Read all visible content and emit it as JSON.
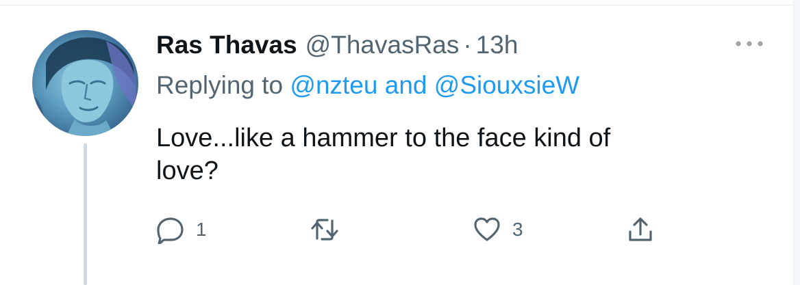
{
  "tweet": {
    "author_name": "Ras Thavas",
    "author_handle": "@ThavasRas",
    "separator": "·",
    "time": "13h",
    "replying_prefix": "Replying to",
    "mention_1": "@nzteu",
    "replying_join": "and",
    "mention_2": "@SiouxsieW",
    "text_line_1": "Love...like a hammer to the face kind of",
    "text_line_2": "love?"
  },
  "actions": {
    "reply_count": "1",
    "like_count": "3"
  },
  "icons": {
    "more": "more-horizontal-icon",
    "reply": "reply-bubble-icon",
    "retweet": "retweet-icon",
    "like": "heart-icon",
    "share": "share-icon"
  },
  "colors": {
    "text": "#0f1419",
    "muted": "#536471",
    "link": "#1d9bf0",
    "thread_line": "#cfd9de"
  }
}
